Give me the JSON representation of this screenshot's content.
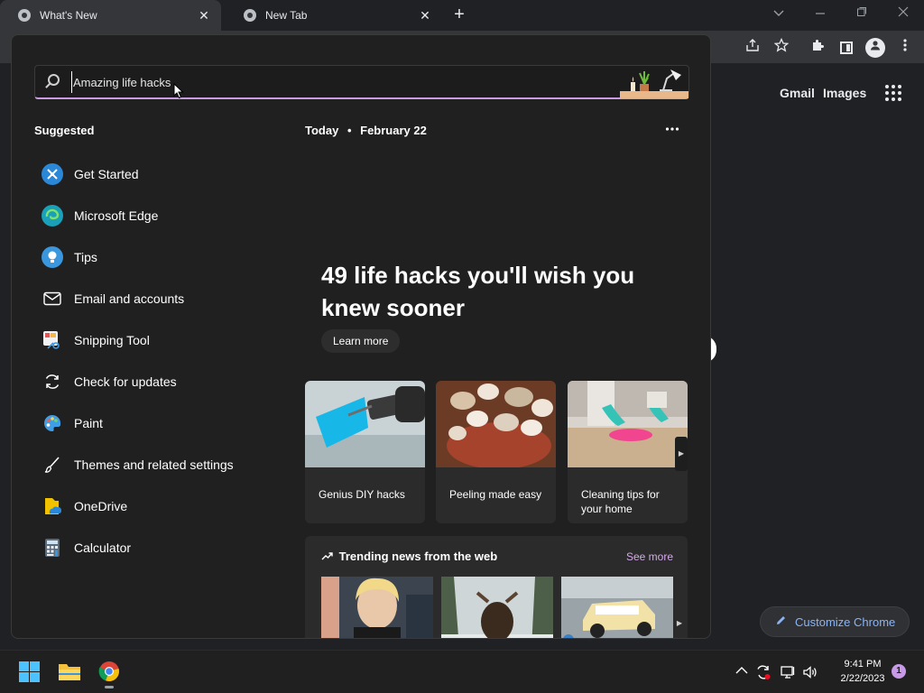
{
  "browser": {
    "tabs": [
      {
        "label": "What's New",
        "active": true
      },
      {
        "label": "New Tab",
        "active": false
      }
    ],
    "new_tab_symbol": "+",
    "close_symbol": "✕",
    "window_controls": [
      "chevron-down",
      "minimize",
      "restore",
      "close"
    ]
  },
  "ntp": {
    "links": {
      "gmail": "Gmail",
      "images": "Images"
    },
    "customize_label": "Customize Chrome"
  },
  "search": {
    "query": "Amazing life hacks"
  },
  "suggested": {
    "heading": "Suggested",
    "items": [
      {
        "label": "Get Started",
        "icon": "get-started-icon",
        "color": "#2b88d8"
      },
      {
        "label": "Microsoft Edge",
        "icon": "edge-icon",
        "color": "#1aa0b8"
      },
      {
        "label": "Tips",
        "icon": "tips-icon",
        "color": "#3a96dd"
      },
      {
        "label": "Email and accounts",
        "icon": "mail-icon",
        "color": "#202020"
      },
      {
        "label": "Snipping Tool",
        "icon": "snipping-tool-icon",
        "color": "#d9534f"
      },
      {
        "label": "Check for updates",
        "icon": "update-icon",
        "color": "#202020"
      },
      {
        "label": "Paint",
        "icon": "paint-icon",
        "color": "#3f9ee6"
      },
      {
        "label": "Themes and related settings",
        "icon": "brush-icon",
        "color": "#202020"
      },
      {
        "label": "OneDrive",
        "icon": "onedrive-icon",
        "color": "#f2c200"
      },
      {
        "label": "Calculator",
        "icon": "calculator-icon",
        "color": "#5c6b7a"
      }
    ]
  },
  "today": {
    "label": "Today",
    "separator": "•",
    "date": "February 22",
    "headline": "49 life hacks you'll wish you knew sooner",
    "learn_more": "Learn more",
    "cards": [
      {
        "caption": "Genius DIY hacks"
      },
      {
        "caption": "Peeling made easy"
      },
      {
        "caption": "Cleaning tips for your home"
      }
    ]
  },
  "trending": {
    "title": "Trending news from the web",
    "see_more": "See more"
  },
  "taskbar": {
    "time": "9:41 PM",
    "date": "2/22/2023",
    "notification_count": "1"
  }
}
